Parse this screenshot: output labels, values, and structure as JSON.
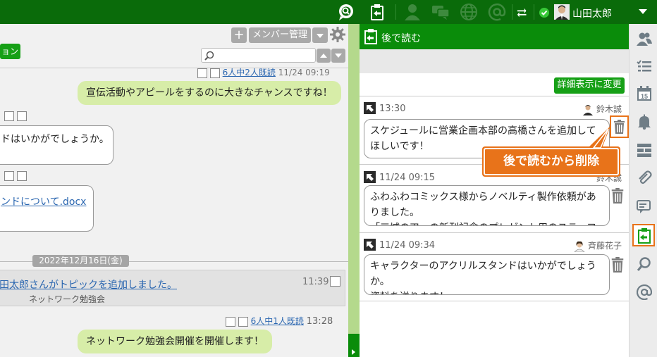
{
  "topbar": {
    "user_name": "山田太郎",
    "icons": [
      "chat-search-icon",
      "read-later-icon",
      "people-icon",
      "messages-icon",
      "globe-icon",
      "at-icon",
      "swap-icon",
      "online-status-icon",
      "avatar",
      "dropdown-icon"
    ]
  },
  "chat": {
    "left_button_label": "ョン",
    "member_button_label": "メンバー管理",
    "search_placeholder": "",
    "messages": [
      {
        "read_text": "6人中2人既読",
        "time": "11/24 09:19",
        "text": "宣伝活動やアピールをするのに大きなチャンスですね！"
      },
      {
        "text": "ドはいかがでしょうか。"
      },
      {
        "link_text": "ンドについて.docx"
      }
    ],
    "date_label": "2022年12月16日(金)",
    "topic": {
      "link_text": "田太郎さんがトピックを追加しました。",
      "time": "11:39",
      "sub_text": "ネットワーク勉強会"
    },
    "last_message": {
      "read_text": "6人中1人既読",
      "time": "13:28",
      "text": "ネットワーク勉強会開催を開催します！"
    }
  },
  "panel": {
    "title": "後で読む",
    "detail_button_label": "詳細表示に変更",
    "callout_label": "後で読むから削除",
    "cards": [
      {
        "time": "13:30",
        "name": "鈴木誠",
        "lines": [
          "スケジュールに営業企画本部の高橋さんを追加して",
          "ほしいです！"
        ]
      },
      {
        "time": "11/24 09:15",
        "name": "鈴木誠",
        "lines": [
          "ふわふわコミックス様からノベルティ製作依頼があ",
          "りました。",
          "「三城の刃」の新刊記念のプレゼント用のステーフ"
        ]
      },
      {
        "time": "11/24 09:34",
        "name": "斉藤花子",
        "lines": [
          "キャラクターのアクリルスタンドはいかがでしょう",
          "か。",
          "資料を送ります！"
        ]
      }
    ]
  },
  "colors": {
    "topbar": "#0a6b0a",
    "panel_header": "#0a8c0a",
    "accent_orange": "#e8731a",
    "bubble_me": "#d7eda8",
    "link": "#2a66b0"
  }
}
